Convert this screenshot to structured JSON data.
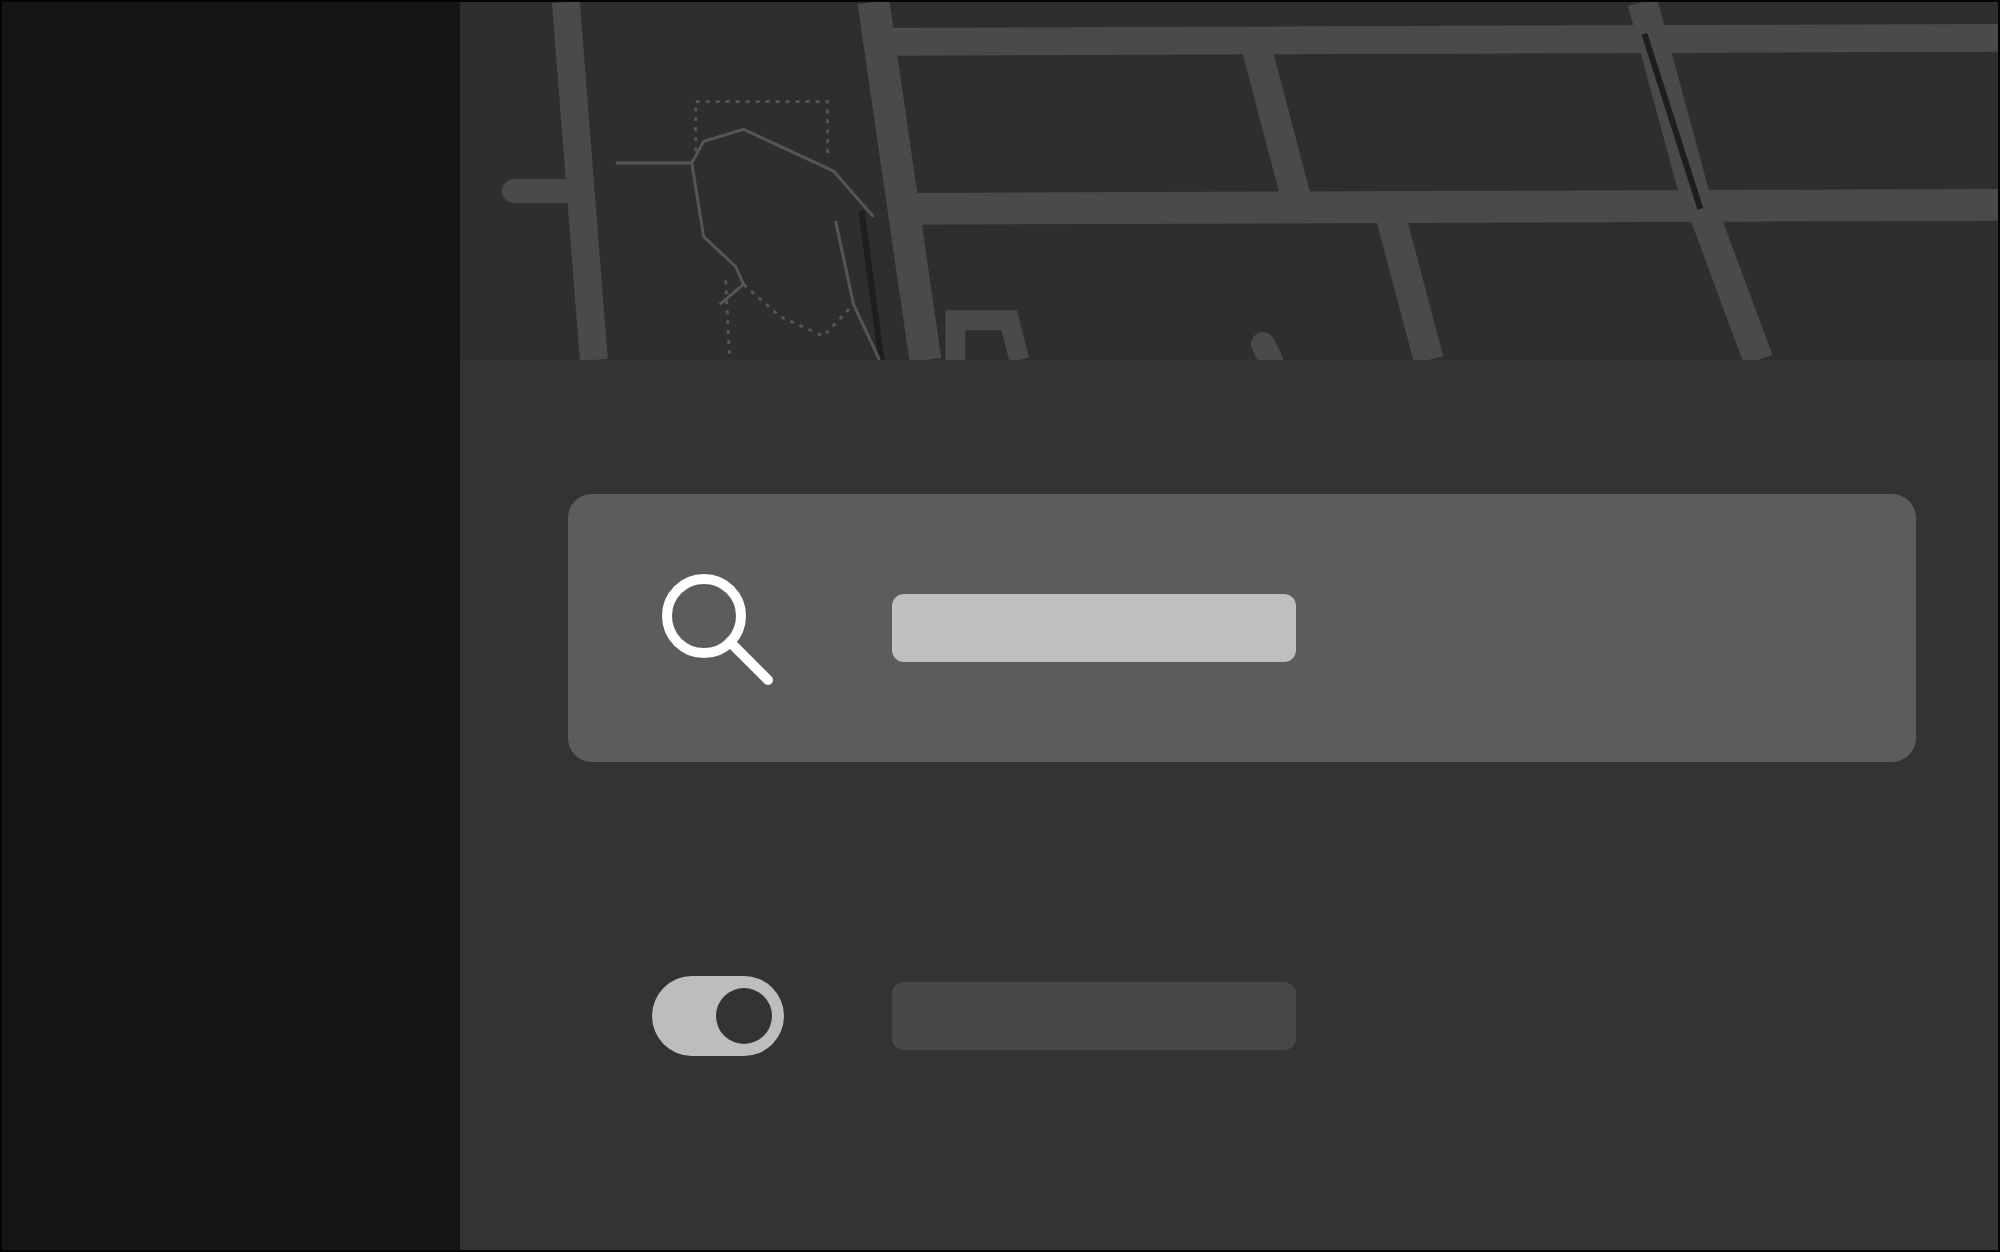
{
  "settings_row": {
    "on": true
  }
}
